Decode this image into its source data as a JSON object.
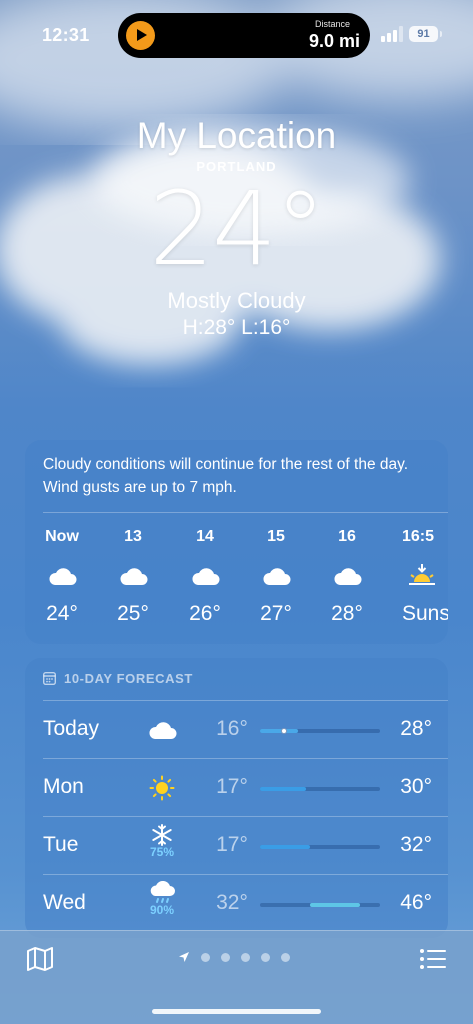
{
  "status_bar": {
    "time": "12:31",
    "live_activity": {
      "label": "Distance",
      "value": "9.0 mi"
    },
    "battery": "91"
  },
  "current": {
    "title": "My Location",
    "city": "PORTLAND",
    "temperature": "24°",
    "condition": "Mostly Cloudy",
    "high_low": "H:28°  L:16°"
  },
  "hourly": {
    "summary": "Cloudy conditions will continue for the rest of the day. Wind gusts are up to 7 mph.",
    "hours": [
      {
        "time": "Now",
        "icon": "cloud-icon",
        "temp": "24°"
      },
      {
        "time": "13",
        "icon": "cloud-icon",
        "temp": "25°"
      },
      {
        "time": "14",
        "icon": "cloud-icon",
        "temp": "26°"
      },
      {
        "time": "15",
        "icon": "cloud-icon",
        "temp": "27°"
      },
      {
        "time": "16",
        "icon": "cloud-icon",
        "temp": "28°"
      },
      {
        "time": "16:5",
        "icon": "sunset-icon",
        "temp": "Suns"
      }
    ]
  },
  "forecast": {
    "header": "10-DAY FORECAST",
    "days": [
      {
        "day": "Today",
        "icon": "cloud-icon",
        "precip": "",
        "low": "16°",
        "high": "28°",
        "bar_start": 0.0,
        "bar_end": 0.32,
        "bar_color": "#4aa8e8",
        "current_marker": 0.2
      },
      {
        "day": "Mon",
        "icon": "sun-icon",
        "precip": "",
        "low": "17°",
        "high": "30°",
        "bar_start": 0.0,
        "bar_end": 0.38,
        "bar_color": "#3a9de6"
      },
      {
        "day": "Tue",
        "icon": "snowflake-icon",
        "precip": "75%",
        "low": "17°",
        "high": "32°",
        "bar_start": 0.0,
        "bar_end": 0.42,
        "bar_color": "#3a9de6"
      },
      {
        "day": "Wed",
        "icon": "cloud-rain-icon",
        "precip": "90%",
        "low": "32°",
        "high": "46°",
        "bar_start": 0.42,
        "bar_end": 0.83,
        "bar_color": "#5ec6e6"
      }
    ]
  }
}
